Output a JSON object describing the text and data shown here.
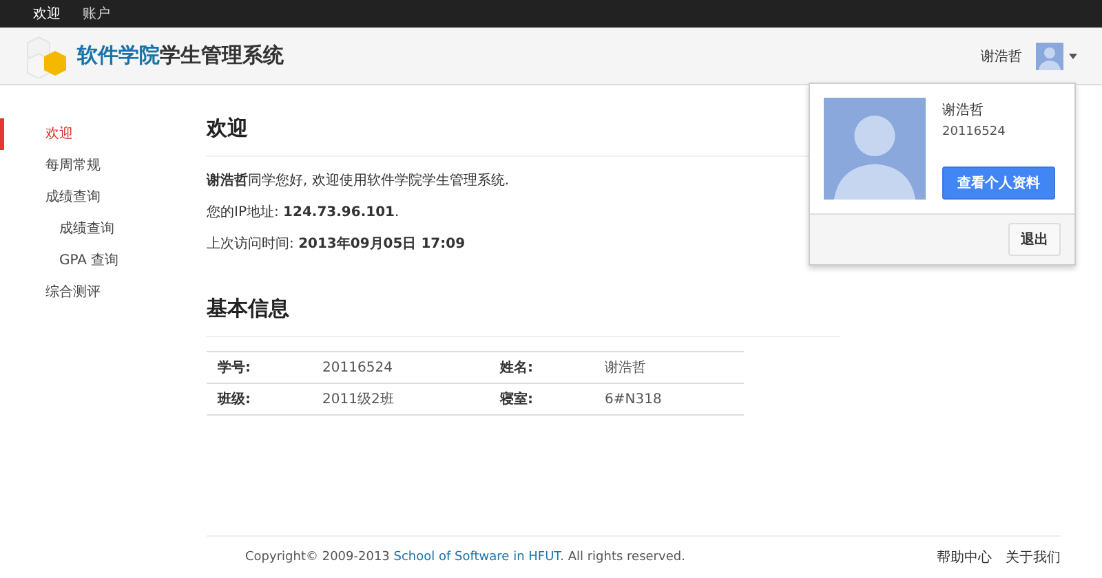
{
  "top_nav": [
    {
      "label": "欢迎",
      "selected": true
    },
    {
      "label": "账户",
      "selected": false
    }
  ],
  "header": {
    "title_highlight": "软件学院",
    "title_rest": "学生管理系统",
    "user_name": "谢浩哲"
  },
  "user_menu": {
    "expanded": true,
    "name": "谢浩哲",
    "id": "20116524",
    "profile_button": "查看个人资料",
    "logout_button": "退出"
  },
  "sidebar": {
    "items": [
      {
        "label": "欢迎",
        "selected": true
      },
      {
        "label": "每周常规",
        "selected": false
      },
      {
        "label": "成绩查询",
        "selected": false,
        "children": [
          {
            "label": "成绩查询",
            "selected": false
          },
          {
            "label": "GPA 查询",
            "selected": false
          }
        ]
      },
      {
        "label": "综合测评",
        "selected": false
      }
    ]
  },
  "welcome": {
    "title": "欢迎",
    "lines": [
      "**谢浩哲**同学您好, 欢迎使用软件学院学生管理系统.",
      "您的IP地址: **124.73.96.101**.",
      "上次访问时间: **2013年09月05日 17:09**"
    ]
  },
  "basic_info": {
    "title": "基本信息",
    "rows": [
      [
        "学号:",
        "20116524",
        "姓名:",
        "谢浩哲"
      ],
      [
        "班级:",
        "2011级2班",
        "寝室:",
        "6#N318"
      ]
    ]
  },
  "footer": {
    "copyright_before": "Copyright© 2009-2013 ",
    "copyright_link": "School of Software in HFUT",
    "copyright_after": ". All rights reserved.",
    "links": [
      "帮助中心",
      "关于我们"
    ]
  }
}
